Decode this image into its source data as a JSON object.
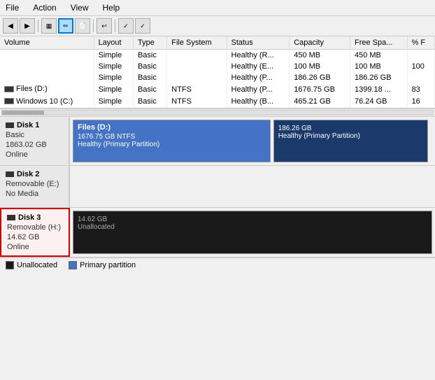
{
  "menu": {
    "items": [
      "File",
      "Action",
      "View",
      "Help"
    ]
  },
  "toolbar": {
    "buttons": [
      "◀",
      "▶",
      "📋",
      "✏️",
      "📄",
      "↩",
      "✓",
      "🔄"
    ]
  },
  "table": {
    "columns": [
      "Volume",
      "Layout",
      "Type",
      "File System",
      "Status",
      "Capacity",
      "Free Spa...",
      "% F"
    ],
    "rows": [
      {
        "volume": "",
        "layout": "Simple",
        "type": "Basic",
        "filesystem": "",
        "status": "Healthy (R...",
        "capacity": "450 MB",
        "free": "450 MB",
        "percent": ""
      },
      {
        "volume": "",
        "layout": "Simple",
        "type": "Basic",
        "filesystem": "",
        "status": "Healthy (E...",
        "capacity": "100 MB",
        "free": "100 MB",
        "percent": "100"
      },
      {
        "volume": "",
        "layout": "Simple",
        "type": "Basic",
        "filesystem": "",
        "status": "Healthy (P...",
        "capacity": "186.26 GB",
        "free": "186.26 GB",
        "percent": ""
      },
      {
        "volume": "Files (D:)",
        "layout": "Simple",
        "type": "Basic",
        "filesystem": "NTFS",
        "status": "Healthy (P...",
        "capacity": "1676.75 GB",
        "free": "1399.18 ...",
        "percent": "83"
      },
      {
        "volume": "Windows 10 (C:)",
        "layout": "Simple",
        "type": "Basic",
        "filesystem": "NTFS",
        "status": "Healthy (B...",
        "capacity": "465.21 GB",
        "free": "76.24 GB",
        "percent": "16"
      }
    ]
  },
  "disks": [
    {
      "id": "disk1",
      "name": "Disk 1",
      "type": "Basic",
      "size": "1863.02 GB",
      "status": "Online",
      "highlighted": false,
      "partitions": [
        {
          "style": "blue",
          "title": "Files (D:)",
          "size": "1676.75 GB NTFS",
          "desc": "Healthy (Primary Partition)"
        },
        {
          "style": "dark-blue",
          "title": "",
          "size": "186.26 GB",
          "desc": "Healthy (Primary Partition)"
        }
      ]
    },
    {
      "id": "disk2",
      "name": "Disk 2",
      "type": "Removable (E:)",
      "size": "",
      "status": "No Media",
      "highlighted": false,
      "partitions": []
    },
    {
      "id": "disk3",
      "name": "Disk 3",
      "type": "Removable (H:)",
      "size": "14.62 GB",
      "status": "Online",
      "highlighted": true,
      "partitions": [
        {
          "style": "black",
          "title": "",
          "size": "14.62 GB",
          "desc": "Unallocated"
        }
      ]
    }
  ],
  "legend": {
    "items": [
      {
        "type": "unallocated",
        "label": "Unallocated"
      },
      {
        "type": "primary",
        "label": "Primary partition"
      }
    ]
  }
}
